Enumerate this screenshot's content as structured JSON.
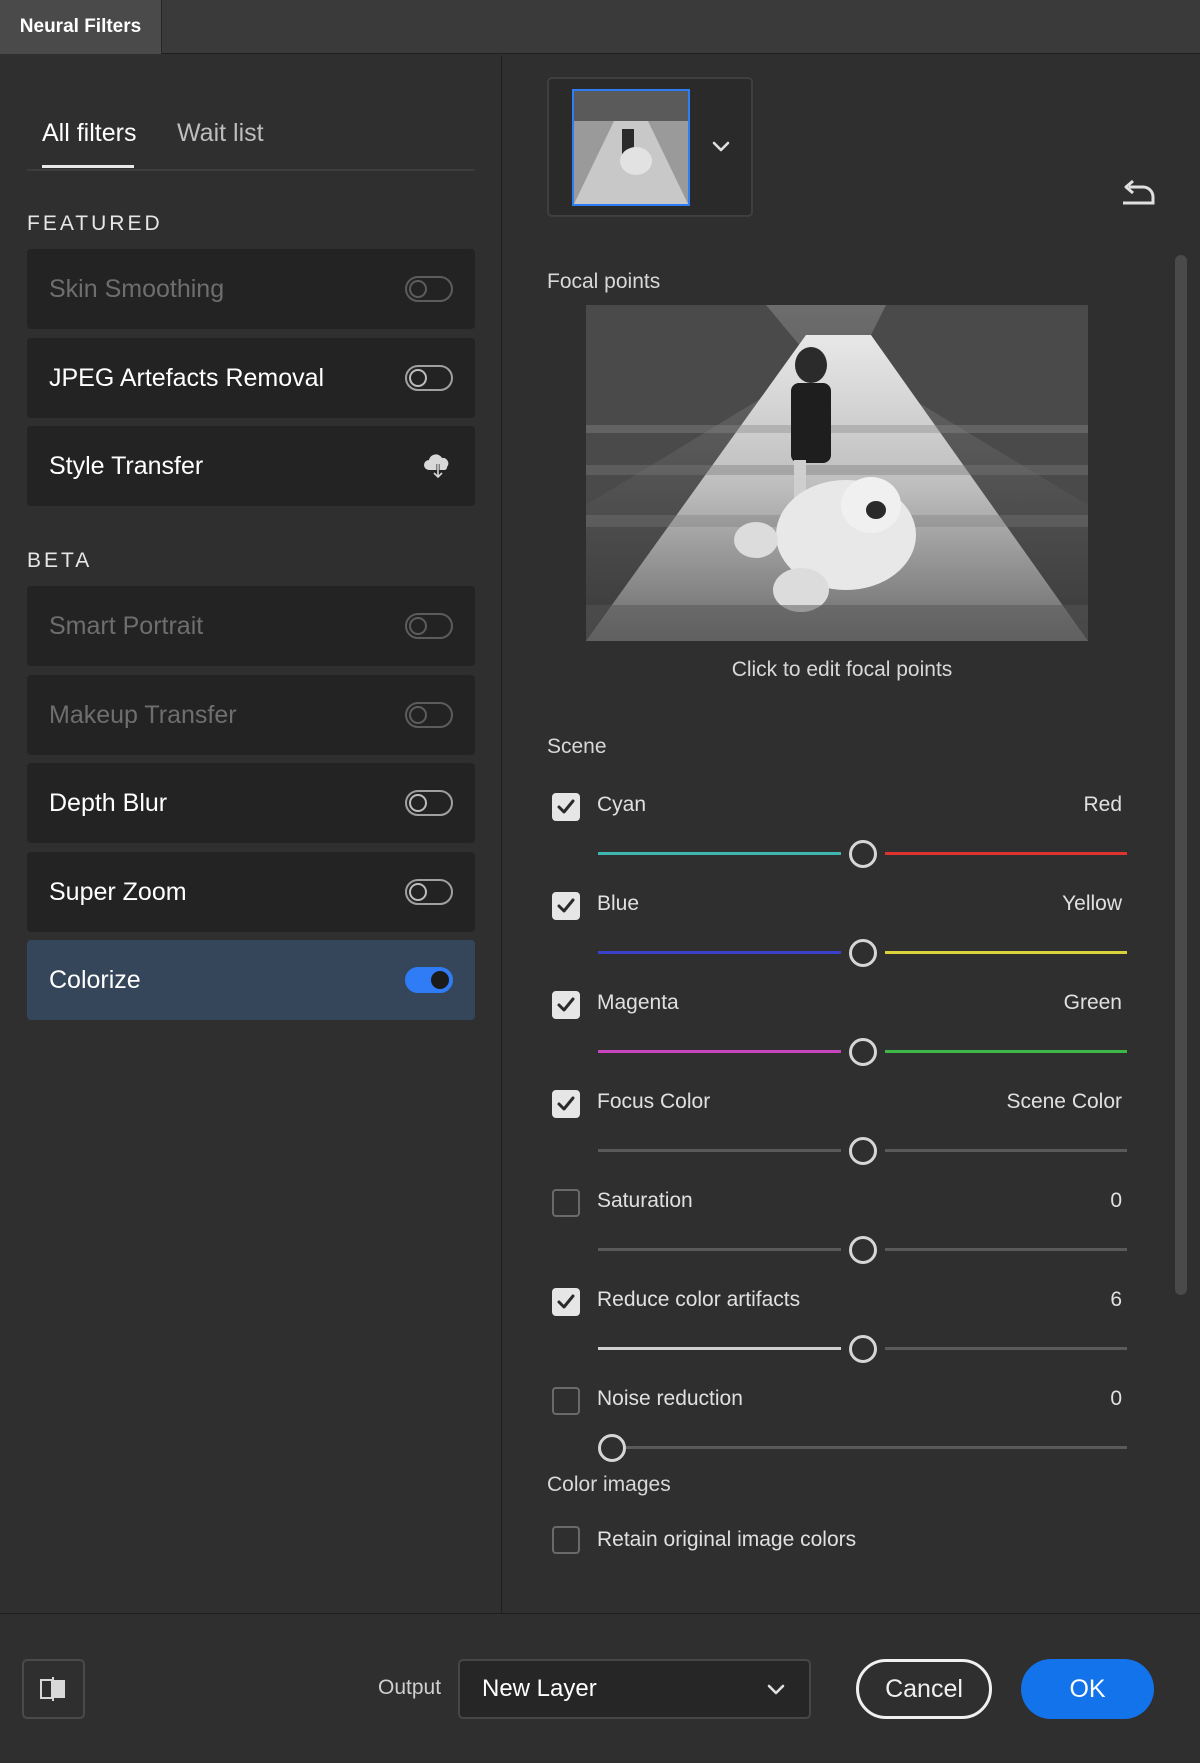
{
  "window": {
    "title": "Neural Filters"
  },
  "left_panel": {
    "tabs": [
      {
        "label": "All filters",
        "active": true
      },
      {
        "label": "Wait list",
        "active": false
      }
    ],
    "sections": {
      "featured": "FEATURED",
      "beta": "BETA"
    },
    "featured_filters": [
      {
        "label": "Skin Smoothing",
        "state": "disabled",
        "control": "toggle-off"
      },
      {
        "label": "JPEG Artefacts Removal",
        "state": "enabled",
        "control": "toggle-off"
      },
      {
        "label": "Style Transfer",
        "state": "enabled",
        "control": "cloud-download-icon"
      }
    ],
    "beta_filters": [
      {
        "label": "Smart Portrait",
        "state": "disabled",
        "control": "toggle-off"
      },
      {
        "label": "Makeup Transfer",
        "state": "disabled",
        "control": "toggle-off"
      },
      {
        "label": "Depth Blur",
        "state": "enabled",
        "control": "toggle-off"
      },
      {
        "label": "Super Zoom",
        "state": "enabled",
        "control": "toggle-off"
      },
      {
        "label": "Colorize",
        "state": "selected",
        "control": "toggle-on"
      }
    ]
  },
  "right_panel": {
    "focal_points_label": "Focal points",
    "preview_caption": "Click to edit focal points",
    "scene_label": "Scene",
    "sliders": [
      {
        "label": "Cyan",
        "right": "Red",
        "checked": true,
        "value": 0.5,
        "left_color": "#3fb7b0",
        "right_color": "#e0322f"
      },
      {
        "label": "Blue",
        "right": "Yellow",
        "checked": true,
        "value": 0.5,
        "left_color": "#3a40c8",
        "right_color": "#d9d23a"
      },
      {
        "label": "Magenta",
        "right": "Green",
        "checked": true,
        "value": 0.5,
        "left_color": "#c845c0",
        "right_color": "#3fb84a"
      },
      {
        "label": "Focus Color",
        "right": "Scene Color",
        "checked": true,
        "value": 0.5,
        "left_color": "#5a5a5a",
        "right_color": "#5a5a5a"
      },
      {
        "label": "Saturation",
        "right": "0",
        "checked": false,
        "value": 0.5,
        "left_color": "#5a5a5a",
        "right_color": "#5a5a5a"
      },
      {
        "label": "Reduce color artifacts",
        "right": "6",
        "checked": true,
        "value": 0.5,
        "left_color": "#d0d0d0",
        "right_color": "#5a5a5a"
      },
      {
        "label": "Noise reduction",
        "right": "0",
        "checked": false,
        "value": 0.0,
        "left_color": "#5a5a5a",
        "right_color": "#5a5a5a"
      }
    ],
    "color_images_label": "Color images",
    "retain_colors": {
      "label": "Retain original image colors",
      "checked": false
    }
  },
  "footer": {
    "output_label": "Output",
    "output_value": "New Layer",
    "cancel_label": "Cancel",
    "ok_label": "OK"
  },
  "colors": {
    "accent": "#1273eb",
    "selected_bg": "#36465a"
  }
}
